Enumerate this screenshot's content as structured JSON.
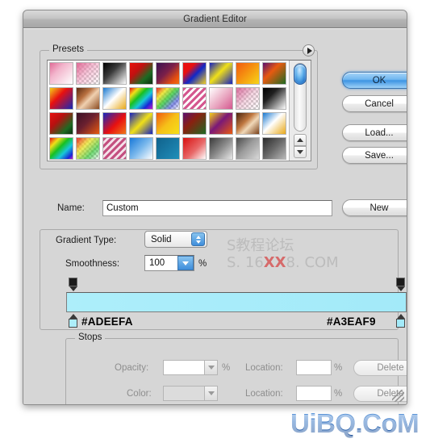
{
  "window": {
    "title": "Gradient Editor"
  },
  "presets": {
    "legend": "Presets",
    "menu_icon": "play-triangle-icon",
    "scroll_up_icon": "triangle-up-icon",
    "scroll_down_icon": "triangle-down-icon",
    "swatches": [
      {
        "name": "pink-to-white",
        "css": "linear-gradient(135deg,#e06a96 0%,#f2b4cb 35%,#ffffff 100%)"
      },
      {
        "name": "pink-to-transparent",
        "css": "linear-gradient(135deg,#e06a96 0%,rgba(240,150,185,0.55) 45%,rgba(255,255,255,0) 100%)",
        "checker": true
      },
      {
        "name": "black-to-white",
        "css": "linear-gradient(135deg,#000000 0%,#3a3a3a 40%,#ffffff 100%)"
      },
      {
        "name": "red-green-black",
        "css": "linear-gradient(135deg,#e8100c 0%,#c21010 35%,#1d6a22 70%,#0b2f10 100%)"
      },
      {
        "name": "purple-orange",
        "css": "linear-gradient(135deg,#3a1150 0%,#7a1f4a 45%,#e8500e 80%,#f07010 100%)"
      },
      {
        "name": "blue-red-yellow",
        "css": "linear-gradient(135deg,#e81010 0%,#e81010 28%,#1028c8 55%,#f2d020 100%)"
      },
      {
        "name": "blue-yellow-blue",
        "css": "linear-gradient(135deg,#1420c0 0%,#f0e018 45%,#1420c0 100%)"
      },
      {
        "name": "orange-yellow",
        "css": "linear-gradient(135deg,#f05a10 0%,#f58a10 40%,#f6d618 100%)"
      },
      {
        "name": "purple-orange-green",
        "css": "linear-gradient(135deg,#5a1070 0%,#e85a10 40%,#1d6a22 100%)"
      },
      {
        "name": "yellow-red-blue",
        "css": "linear-gradient(135deg,#f5d018 0%,#e81010 40%,#1428b8 100%)"
      },
      {
        "name": "copper",
        "css": "linear-gradient(135deg,#5a2a10 0%,#b87040 35%,#f0d0b0 55%,#8a4a20 100%)"
      },
      {
        "name": "blue-white-gold",
        "css": "linear-gradient(135deg,#1878d0 0%,#ffffff 48%,#e8a818 100%)"
      },
      {
        "name": "spectrum",
        "css": "linear-gradient(135deg,#e81010 0%,#f0e018 20%,#18c020 40%,#18c8d8 60%,#1828d8 80%,#c818c8 100%)"
      },
      {
        "name": "transparent-rainbow",
        "css": "linear-gradient(135deg,rgba(232,16,16,0.9) 0%,rgba(240,224,24,0.8) 25%,rgba(24,192,32,0.7) 50%,rgba(24,40,216,0.5) 75%,rgba(255,255,255,0) 100%)",
        "checker": true
      },
      {
        "name": "pink-stripes",
        "css": "repeating-linear-gradient(135deg,#d4578f 0px,#d4578f 3px,#ffffff 3px,#ffffff 6px)"
      },
      {
        "name": "pink-gradient",
        "css": "linear-gradient(135deg,#ffffff 0%,#e9a6c0 55%,#d4578f 100%)"
      },
      {
        "name": "pink-checker-fade",
        "css": "linear-gradient(135deg,rgba(212,87,143,0.85) 0%,rgba(233,166,192,0.45) 50%,rgba(255,255,255,0) 100%)",
        "checker": true
      },
      {
        "name": "black-to-white-2",
        "css": "linear-gradient(135deg,#000000 0%,#202020 35%,#ffffff 100%)"
      },
      {
        "name": "red-green-dark",
        "css": "linear-gradient(135deg,#e81010 0%,#b81010 35%,#1d6a22 75%,#0b2f10 100%)"
      },
      {
        "name": "maroon-orange",
        "css": "linear-gradient(135deg,#3a1024 0%,#6a2030 45%,#e85a10 100%)"
      },
      {
        "name": "blue-red-orange",
        "css": "linear-gradient(135deg,#1428c0 0%,#e81010 55%,#f07818 100%)"
      },
      {
        "name": "blue-yellow",
        "css": "linear-gradient(135deg,#1420c0 0%,#f0e018 50%,#1420c0 100%)"
      },
      {
        "name": "orange-yellow-2",
        "css": "linear-gradient(135deg,#f05a10 0%,#f6c018 50%,#f5e018 100%)"
      },
      {
        "name": "purple-green",
        "css": "linear-gradient(135deg,#5a1070 0%,#8a2010 40%,#1d6a22 100%)"
      },
      {
        "name": "yellow-purple-orange",
        "css": "linear-gradient(135deg,#f5d018 0%,#7a1878 45%,#e85a10 100%)"
      },
      {
        "name": "copper-2",
        "css": "linear-gradient(135deg,#4a2410 0%,#c07840 40%,#f0d8b8 60%,#7a4018 100%)"
      },
      {
        "name": "blue-gold",
        "css": "linear-gradient(135deg,#1878d0 0%,#ffffff 45%,#e8a818 100%)"
      },
      {
        "name": "spectrum-2",
        "css": "linear-gradient(135deg,#e81010 0%,#f0e018 22%,#18c020 44%,#18c8d8 66%,#1828d8 88%,#c818c8 100%)"
      },
      {
        "name": "rainbow-checker",
        "css": "linear-gradient(135deg,rgba(232,16,16,0.85) 0%,rgba(240,224,24,0.7) 35%,rgba(24,192,32,0.6) 70%,rgba(255,255,255,0) 100%)",
        "checker": true
      },
      {
        "name": "pink-stripes-2",
        "css": "repeating-linear-gradient(135deg,#c45080 0px,#c45080 3px,#f5e2ea 3px,#f5e2ea 6px)"
      },
      {
        "name": "blue-to-white",
        "css": "linear-gradient(135deg,#1878d8 0%,#7ab8ec 50%,#ffffff 100%)"
      },
      {
        "name": "teal-solid",
        "css": "linear-gradient(135deg,#10628c 0%,#1a7ca8 60%,#2090b8 100%)"
      },
      {
        "name": "red-to-white",
        "css": "linear-gradient(135deg,#d81010 0%,#e86868 55%,#ffffff 100%)"
      },
      {
        "name": "grey-fade",
        "css": "linear-gradient(135deg,#3a3a3a 0%,#8a8a8a 50%,#e8e8e8 100%)"
      },
      {
        "name": "steel-grey",
        "css": "linear-gradient(135deg,#4a4a4a 0%,#9a9a9a 45%,#d8d8d8 100%)"
      },
      {
        "name": "dark-grey",
        "css": "linear-gradient(135deg,#2a2a2a 0%,#6a6a6a 50%,#b8b8b8 100%)"
      }
    ]
  },
  "buttons": {
    "ok": "OK",
    "cancel": "Cancel",
    "load": "Load...",
    "save": "Save...",
    "new": "New"
  },
  "name_row": {
    "label": "Name:",
    "value": "Custom"
  },
  "gradient_type": {
    "label": "Gradient Type:",
    "value": "Solid",
    "stepper_icon": "stepper-up-down-icon"
  },
  "smoothness": {
    "label": "Smoothness:",
    "value": "100",
    "unit": "%",
    "arrow_icon": "chevron-down-icon"
  },
  "gradient_bar": {
    "left_color": "#ADEEFA",
    "right_color": "#A3EAF9",
    "left_hex_label": "#ADEEFA",
    "right_hex_label": "#A3EAF9"
  },
  "stops": {
    "legend": "Stops",
    "opacity_label": "Opacity:",
    "opacity_value": "",
    "opacity_unit": "%",
    "color_label": "Color:",
    "color_value": "",
    "location1_label": "Location:",
    "location1_value": "",
    "location1_unit": "%",
    "location2_label": "Location:",
    "location2_value": "",
    "location2_unit": "%",
    "delete1": "Delete",
    "delete2": "Delete"
  },
  "watermarks": {
    "middle_line1": "S教程论坛",
    "middle_line2_a": "S. 16",
    "middle_line2_b": "XX",
    "middle_line2_c": "8. COM",
    "bottom": "UiBQ.CoM"
  }
}
